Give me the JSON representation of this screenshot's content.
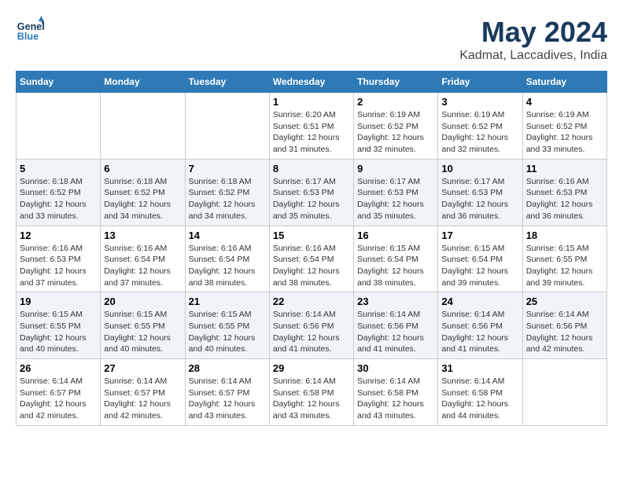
{
  "header": {
    "logo_line1": "General",
    "logo_line2": "Blue",
    "month": "May 2024",
    "location": "Kadmat, Laccadives, India"
  },
  "weekdays": [
    "Sunday",
    "Monday",
    "Tuesday",
    "Wednesday",
    "Thursday",
    "Friday",
    "Saturday"
  ],
  "weeks": [
    [
      {
        "day": "",
        "info": ""
      },
      {
        "day": "",
        "info": ""
      },
      {
        "day": "",
        "info": ""
      },
      {
        "day": "1",
        "info": "Sunrise: 6:20 AM\nSunset: 6:51 PM\nDaylight: 12 hours\nand 31 minutes."
      },
      {
        "day": "2",
        "info": "Sunrise: 6:19 AM\nSunset: 6:52 PM\nDaylight: 12 hours\nand 32 minutes."
      },
      {
        "day": "3",
        "info": "Sunrise: 6:19 AM\nSunset: 6:52 PM\nDaylight: 12 hours\nand 32 minutes."
      },
      {
        "day": "4",
        "info": "Sunrise: 6:19 AM\nSunset: 6:52 PM\nDaylight: 12 hours\nand 33 minutes."
      }
    ],
    [
      {
        "day": "5",
        "info": "Sunrise: 6:18 AM\nSunset: 6:52 PM\nDaylight: 12 hours\nand 33 minutes."
      },
      {
        "day": "6",
        "info": "Sunrise: 6:18 AM\nSunset: 6:52 PM\nDaylight: 12 hours\nand 34 minutes."
      },
      {
        "day": "7",
        "info": "Sunrise: 6:18 AM\nSunset: 6:52 PM\nDaylight: 12 hours\nand 34 minutes."
      },
      {
        "day": "8",
        "info": "Sunrise: 6:17 AM\nSunset: 6:53 PM\nDaylight: 12 hours\nand 35 minutes."
      },
      {
        "day": "9",
        "info": "Sunrise: 6:17 AM\nSunset: 6:53 PM\nDaylight: 12 hours\nand 35 minutes."
      },
      {
        "day": "10",
        "info": "Sunrise: 6:17 AM\nSunset: 6:53 PM\nDaylight: 12 hours\nand 36 minutes."
      },
      {
        "day": "11",
        "info": "Sunrise: 6:16 AM\nSunset: 6:53 PM\nDaylight: 12 hours\nand 36 minutes."
      }
    ],
    [
      {
        "day": "12",
        "info": "Sunrise: 6:16 AM\nSunset: 6:53 PM\nDaylight: 12 hours\nand 37 minutes."
      },
      {
        "day": "13",
        "info": "Sunrise: 6:16 AM\nSunset: 6:54 PM\nDaylight: 12 hours\nand 37 minutes."
      },
      {
        "day": "14",
        "info": "Sunrise: 6:16 AM\nSunset: 6:54 PM\nDaylight: 12 hours\nand 38 minutes."
      },
      {
        "day": "15",
        "info": "Sunrise: 6:16 AM\nSunset: 6:54 PM\nDaylight: 12 hours\nand 38 minutes."
      },
      {
        "day": "16",
        "info": "Sunrise: 6:15 AM\nSunset: 6:54 PM\nDaylight: 12 hours\nand 38 minutes."
      },
      {
        "day": "17",
        "info": "Sunrise: 6:15 AM\nSunset: 6:54 PM\nDaylight: 12 hours\nand 39 minutes."
      },
      {
        "day": "18",
        "info": "Sunrise: 6:15 AM\nSunset: 6:55 PM\nDaylight: 12 hours\nand 39 minutes."
      }
    ],
    [
      {
        "day": "19",
        "info": "Sunrise: 6:15 AM\nSunset: 6:55 PM\nDaylight: 12 hours\nand 40 minutes."
      },
      {
        "day": "20",
        "info": "Sunrise: 6:15 AM\nSunset: 6:55 PM\nDaylight: 12 hours\nand 40 minutes."
      },
      {
        "day": "21",
        "info": "Sunrise: 6:15 AM\nSunset: 6:55 PM\nDaylight: 12 hours\nand 40 minutes."
      },
      {
        "day": "22",
        "info": "Sunrise: 6:14 AM\nSunset: 6:56 PM\nDaylight: 12 hours\nand 41 minutes."
      },
      {
        "day": "23",
        "info": "Sunrise: 6:14 AM\nSunset: 6:56 PM\nDaylight: 12 hours\nand 41 minutes."
      },
      {
        "day": "24",
        "info": "Sunrise: 6:14 AM\nSunset: 6:56 PM\nDaylight: 12 hours\nand 41 minutes."
      },
      {
        "day": "25",
        "info": "Sunrise: 6:14 AM\nSunset: 6:56 PM\nDaylight: 12 hours\nand 42 minutes."
      }
    ],
    [
      {
        "day": "26",
        "info": "Sunrise: 6:14 AM\nSunset: 6:57 PM\nDaylight: 12 hours\nand 42 minutes."
      },
      {
        "day": "27",
        "info": "Sunrise: 6:14 AM\nSunset: 6:57 PM\nDaylight: 12 hours\nand 42 minutes."
      },
      {
        "day": "28",
        "info": "Sunrise: 6:14 AM\nSunset: 6:57 PM\nDaylight: 12 hours\nand 43 minutes."
      },
      {
        "day": "29",
        "info": "Sunrise: 6:14 AM\nSunset: 6:58 PM\nDaylight: 12 hours\nand 43 minutes."
      },
      {
        "day": "30",
        "info": "Sunrise: 6:14 AM\nSunset: 6:58 PM\nDaylight: 12 hours\nand 43 minutes."
      },
      {
        "day": "31",
        "info": "Sunrise: 6:14 AM\nSunset: 6:58 PM\nDaylight: 12 hours\nand 44 minutes."
      },
      {
        "day": "",
        "info": ""
      }
    ]
  ]
}
